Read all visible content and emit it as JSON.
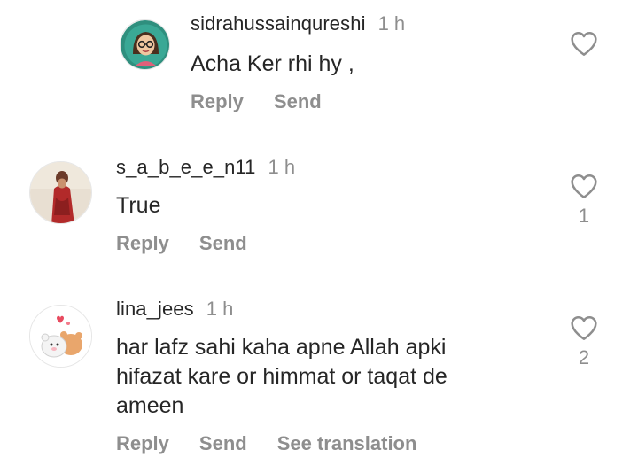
{
  "comments": [
    {
      "username": "sidrahussainqureshi",
      "time": "1 h",
      "text": "Acha Ker rhi hy ,",
      "actions": [
        "Reply",
        "Send"
      ],
      "likes": "",
      "avatar": "cartoon-woman-glasses"
    },
    {
      "username": "s_a_b_e_e_n11",
      "time": "1 h",
      "text": "True",
      "actions": [
        "Reply",
        "Send"
      ],
      "likes": "1",
      "avatar": "woman-red-dress"
    },
    {
      "username": "lina_jees",
      "time": "1 h",
      "text": "har lafz sahi kaha apne Allah apki hifazat kare or himmat or taqat de ameen",
      "actions": [
        "Reply",
        "Send",
        "See translation"
      ],
      "likes": "2",
      "avatar": "cute-bears-hug"
    }
  ],
  "colors": {
    "text": "#262626",
    "secondary": "#8e8e8e"
  },
  "icons": {
    "like": "heart-outline-icon"
  }
}
